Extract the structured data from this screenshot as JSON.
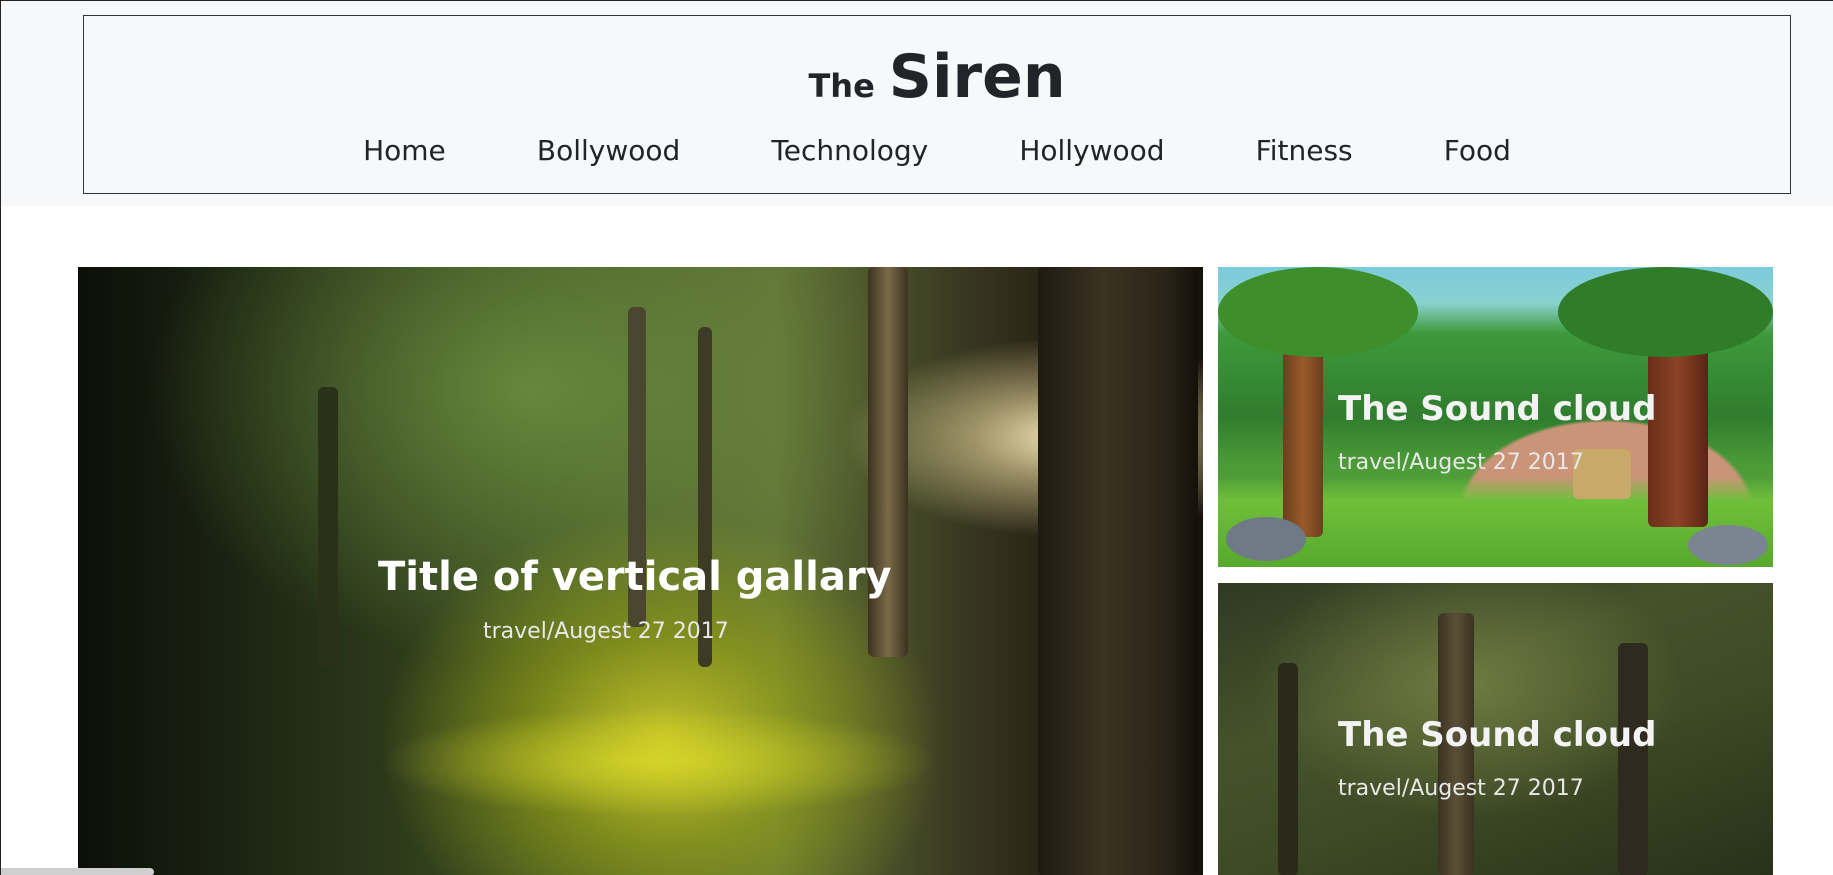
{
  "header": {
    "brand_small": "The",
    "brand_large": "Siren",
    "nav": [
      "Home",
      "Bollywood",
      "Technology",
      "Hollywood",
      "Fitness",
      "Food"
    ]
  },
  "featured": {
    "title": "Title of vertical gallary",
    "meta": "travel/Augest 27 2017"
  },
  "side_cards": [
    {
      "title": "The Sound cloud",
      "meta": "travel/Augest 27 2017"
    },
    {
      "title": "The Sound cloud",
      "meta": "travel/Augest 27 2017"
    }
  ]
}
